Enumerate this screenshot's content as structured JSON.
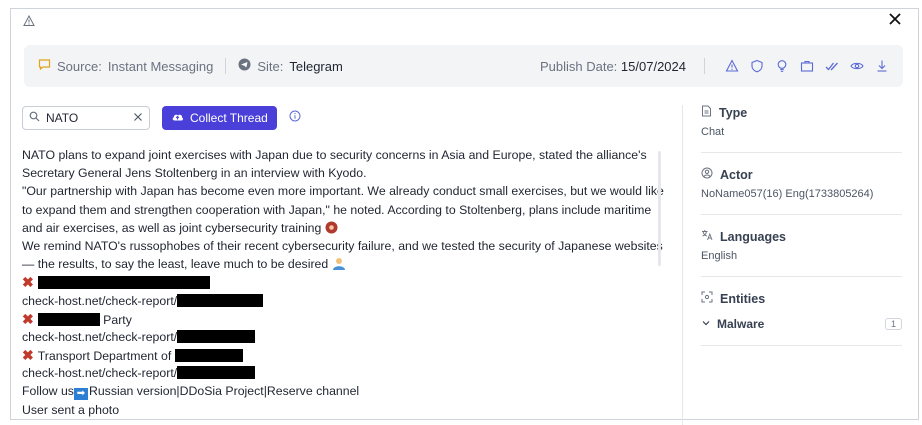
{
  "meta": {
    "source_label": "Source:",
    "source_value": "Instant Messaging",
    "site_label": "Site:",
    "site_value": "Telegram",
    "publish_label": "Publish Date:",
    "publish_value": "15/07/2024"
  },
  "search": {
    "value": "NATO"
  },
  "collect_button": {
    "label": "Collect Thread"
  },
  "message": {
    "line1": "NATO plans to expand joint exercises with Japan due to security concerns in Asia and Europe, stated the alliance's",
    "line2": "Secretary General Jens Stoltenberg in an interview with Kyodo.",
    "line3": "\"Our partnership with Japan has become even more important. We already conduct small exercises, but we would like",
    "line4": "to expand them and strengthen cooperation with Japan,\" he noted. According to Stoltenberg, plans include maritime",
    "line5": "and air exercises, as well as joint cybersecurity training",
    "line6": "We remind NATO's russophobes of their recent cybersecurity failure, and we tested the security of Japanese websites",
    "line7": "— the results, to say the least, leave much to be desired",
    "link_prefix": "check-host.net/check-report/",
    "item2_suffix": " Party",
    "item3_prefix": "Transport Department of ",
    "follow_prefix": "Follow us",
    "follow_links": "Russian version|DDoSia Project|Reserve channel",
    "photo_note": "User sent a photo"
  },
  "sidebar": {
    "type_title": "Type",
    "type_value": "Chat",
    "actor_title": "Actor",
    "actor_value": "NoName057(16) Eng(1733805264)",
    "languages_title": "Languages",
    "languages_value": "English",
    "entities_title": "Entities",
    "malware_label": "Malware",
    "malware_count": "1"
  }
}
